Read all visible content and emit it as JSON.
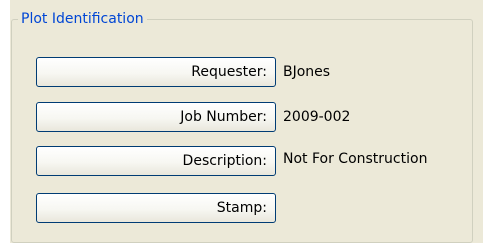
{
  "group": {
    "title": "Plot Identification"
  },
  "fields": [
    {
      "label": "Requester:",
      "value": "BJones"
    },
    {
      "label": "Job Number:",
      "value": "2009-002"
    },
    {
      "label": "Description:",
      "value": "Not For Construction"
    },
    {
      "label": "Stamp:",
      "value": ""
    }
  ]
}
